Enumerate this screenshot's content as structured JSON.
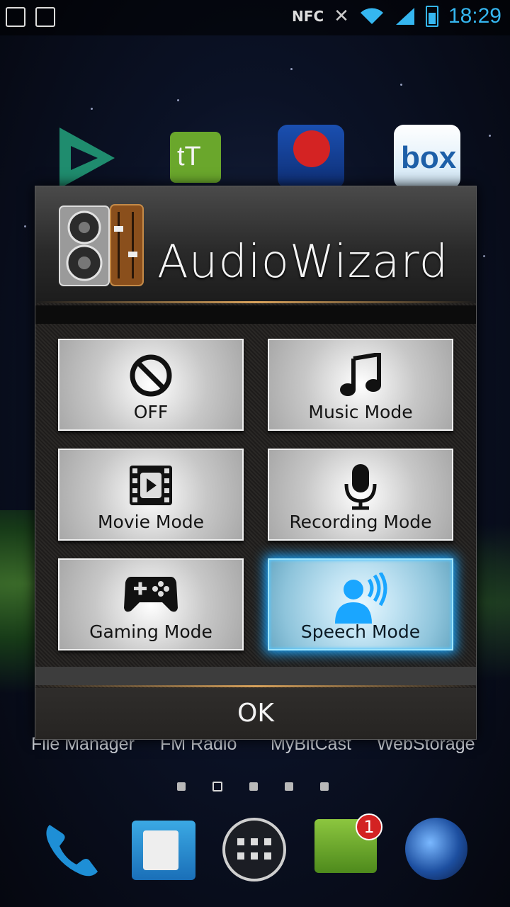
{
  "status_bar": {
    "nfc": "NFC",
    "time": "18:29"
  },
  "home": {
    "labels": [
      "File Manager",
      "FM Radio",
      "MyBitCast",
      "WebStorage"
    ],
    "top_icons": [
      "video-app-icon",
      "tt-app-icon",
      "angry-birds-space-icon",
      "box-app-icon"
    ],
    "box_text": "box",
    "tt_text": "tT",
    "page_count": 5,
    "current_page": 2,
    "dock": [
      "phone-icon",
      "contacts-icon",
      "app-drawer-icon",
      "messaging-icon",
      "browser-icon"
    ],
    "message_badge": "1"
  },
  "dialog": {
    "title": "AudioWizard",
    "modes": [
      {
        "label": "OFF",
        "icon": "off-icon",
        "active": false
      },
      {
        "label": "Music Mode",
        "icon": "music-note-icon",
        "active": false
      },
      {
        "label": "Movie Mode",
        "icon": "film-icon",
        "active": false
      },
      {
        "label": "Recording Mode",
        "icon": "microphone-icon",
        "active": false
      },
      {
        "label": "Gaming Mode",
        "icon": "gamepad-icon",
        "active": false
      },
      {
        "label": "Speech Mode",
        "icon": "speech-person-icon",
        "active": true
      }
    ],
    "ok_label": "OK"
  },
  "colors": {
    "accent": "#35b6f0",
    "active_glow": "#1aa6ff",
    "gold_line": "#d9a35c"
  }
}
